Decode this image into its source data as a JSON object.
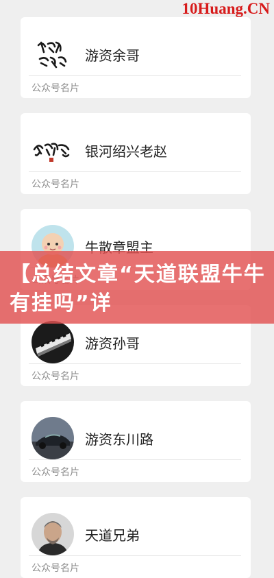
{
  "watermark": "10Huang.CN",
  "caption": "公众号名片",
  "cards": [
    {
      "name": "游资余哥",
      "avatar_icon": "calligraphy-logo-icon"
    },
    {
      "name": "银河绍兴老赵",
      "avatar_icon": "calligraphy-logo-icon"
    },
    {
      "name": "牛散章盟主",
      "avatar_icon": "monk-cartoon-icon"
    },
    {
      "name": "游资孙哥",
      "avatar_icon": "piano-keys-icon"
    },
    {
      "name": "游资东川路",
      "avatar_icon": "sports-car-icon"
    },
    {
      "name": "天道兄弟",
      "avatar_icon": "man-portrait-icon"
    }
  ],
  "banner": {
    "text": "【总结文章“天道联盟牛牛有挂吗”详"
  },
  "colors": {
    "background": "#efefef",
    "watermark": "#d71b1b",
    "banner": "#e25252"
  }
}
